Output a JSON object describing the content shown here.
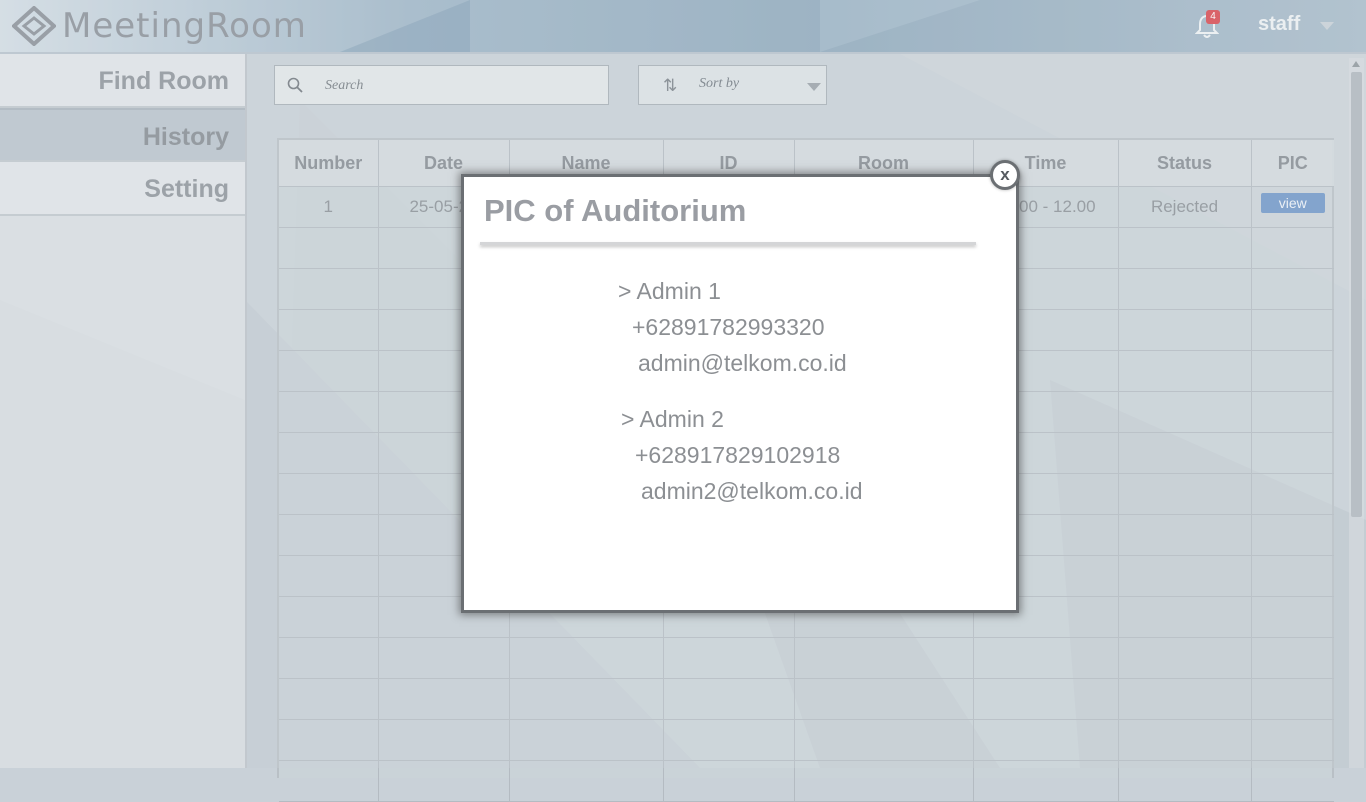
{
  "app": {
    "name": "MeetingRoom"
  },
  "header": {
    "notification_count": "4",
    "user_name": "staff"
  },
  "sidebar": {
    "items": [
      {
        "label": "Find Room",
        "active": false
      },
      {
        "label": "History",
        "active": true
      },
      {
        "label": "Setting",
        "active": false
      }
    ]
  },
  "toolbar": {
    "search_placeholder": "Search",
    "sort_label": "Sort by"
  },
  "table": {
    "columns": [
      "Number",
      "Date",
      "Name",
      "ID",
      "Room",
      "Time",
      "Status",
      "PIC"
    ],
    "rows": [
      {
        "number": "1",
        "date": "25-05-20",
        "name": "",
        "id": "",
        "room": "",
        "time": "10.00 - 12.00",
        "status": "Rejected",
        "pic": "view"
      }
    ]
  },
  "modal": {
    "title": "PIC of Auditorium",
    "close_label": "x",
    "contacts": [
      {
        "name": "> Admin 1",
        "phone": "+62891782993320",
        "email": "admin@telkom.co.id"
      },
      {
        "name": "> Admin 2",
        "phone": "+628917829102918",
        "email": "admin2@telkom.co.id"
      }
    ]
  },
  "colors": {
    "accent_button": "#6f97c9",
    "badge": "#d8474f",
    "modal_border": "#6b6f73"
  }
}
